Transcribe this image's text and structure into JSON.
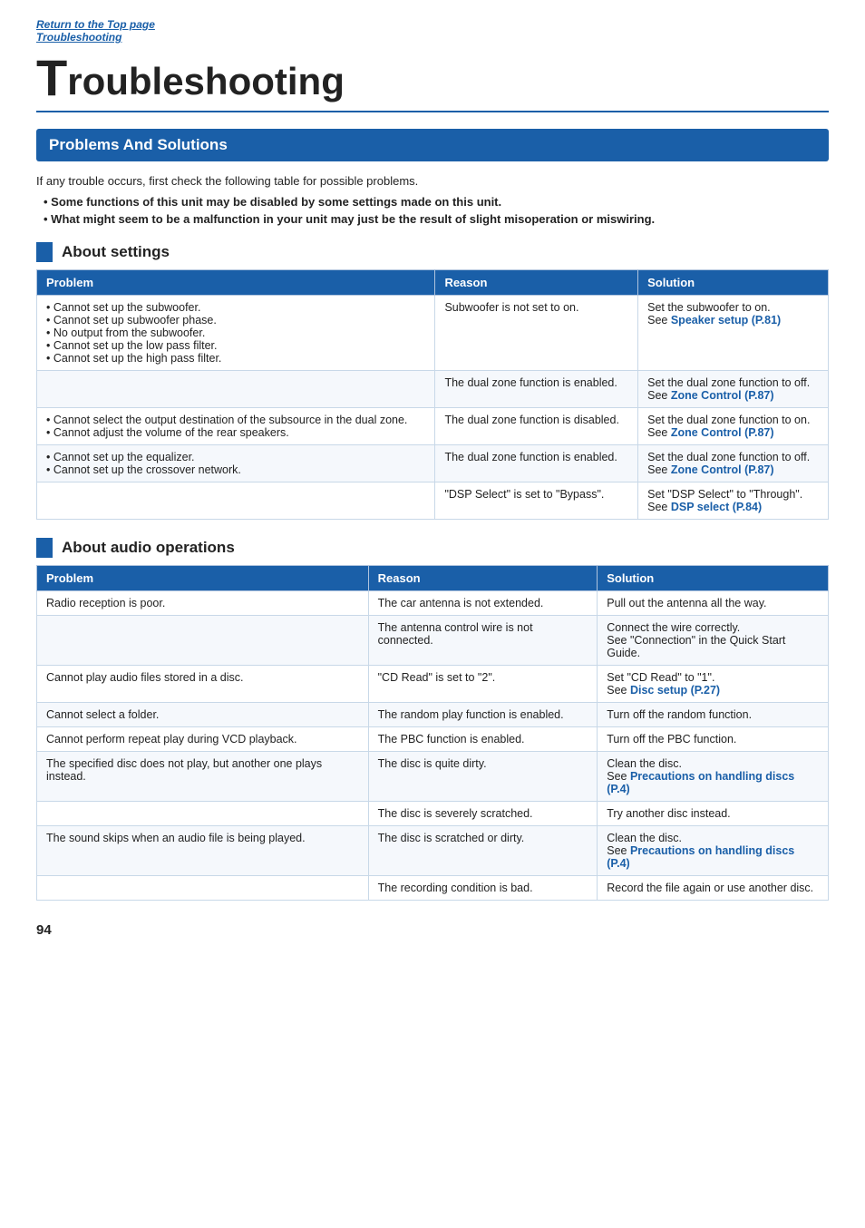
{
  "breadcrumb": {
    "link1": "Return to the Top page",
    "link2": "Troubleshooting"
  },
  "page_title_prefix": "T",
  "page_title_rest": "roubleshooting",
  "main_section": "Problems And Solutions",
  "intro": {
    "line1": "If any trouble occurs, first check the following table for possible problems.",
    "bullet1": "Some functions of this unit may be disabled by some settings made on this unit.",
    "bullet2": "What might seem to be a malfunction in your unit may just be the result of slight misoperation or miswiring."
  },
  "about_settings": {
    "title": "About settings",
    "columns": [
      "Problem",
      "Reason",
      "Solution"
    ],
    "rows": [
      {
        "problem": "• Cannot set up the subwoofer.\n• Cannot set up subwoofer phase.\n• No output from the subwoofer.\n• Cannot set up the low pass filter.\n• Cannot set up the high pass filter.",
        "reason": "Subwoofer is not set to on.",
        "solution": "Set the subwoofer to on.\nSee ",
        "solution_link": "Speaker setup (P.81)",
        "solution_end": ""
      },
      {
        "problem": "",
        "reason": "The dual zone function is enabled.",
        "solution": "Set the dual zone function to off.\nSee ",
        "solution_link": "Zone Control (P.87)",
        "solution_end": ""
      },
      {
        "problem": "• Cannot select the output destination of the subsource in the dual zone.\n• Cannot adjust the volume of the rear speakers.",
        "reason": "The dual zone function is disabled.",
        "solution": "Set the dual zone function to on.\nSee ",
        "solution_link": "Zone Control (P.87)",
        "solution_end": ""
      },
      {
        "problem": "• Cannot set up the equalizer.\n• Cannot set up the crossover network.",
        "reason": "The dual zone function is enabled.",
        "solution": "Set the dual zone function to off.\nSee ",
        "solution_link": "Zone Control (P.87)",
        "solution_end": ""
      },
      {
        "problem": "",
        "reason": "\"DSP Select\" is set to \"Bypass\".",
        "solution": "Set \"DSP Select\" to \"Through\".\nSee ",
        "solution_link": "DSP select (P.84)",
        "solution_end": ""
      }
    ]
  },
  "about_audio": {
    "title": "About audio operations",
    "columns": [
      "Problem",
      "Reason",
      "Solution"
    ],
    "rows": [
      {
        "problem": "Radio reception is poor.",
        "reason": "The car antenna is not extended.",
        "solution": "Pull out the antenna all the way.",
        "solution_link": "",
        "solution_end": ""
      },
      {
        "problem": "",
        "reason": "The antenna control wire is not connected.",
        "solution": "Connect the wire correctly.\nSee \"Connection\" in the Quick Start Guide.",
        "solution_link": "",
        "solution_end": ""
      },
      {
        "problem": "Cannot play audio files stored in a disc.",
        "reason": "\"CD Read\" is set to \"2\".",
        "solution": "Set \"CD Read\" to \"1\".\nSee ",
        "solution_link": "Disc setup (P.27)",
        "solution_end": ""
      },
      {
        "problem": "Cannot select a folder.",
        "reason": "The random play function is enabled.",
        "solution": "Turn off the random function.",
        "solution_link": "",
        "solution_end": ""
      },
      {
        "problem": "Cannot perform repeat play during VCD playback.",
        "reason": "The PBC function is enabled.",
        "solution": "Turn off the PBC function.",
        "solution_link": "",
        "solution_end": ""
      },
      {
        "problem": "The specified disc does not play, but another one plays instead.",
        "reason": "The disc is quite dirty.",
        "solution": "Clean the disc.\nSee ",
        "solution_link": "Precautions on handling discs (P.4)",
        "solution_end": ""
      },
      {
        "problem": "",
        "reason": "The disc is severely scratched.",
        "solution": "Try another disc instead.",
        "solution_link": "",
        "solution_end": ""
      },
      {
        "problem": "The sound skips when an audio file is being played.",
        "reason": "The disc is scratched or dirty.",
        "solution": "Clean the disc.\nSee ",
        "solution_link": "Precautions on handling discs (P.4)",
        "solution_end": ""
      },
      {
        "problem": "",
        "reason": "The recording condition is bad.",
        "solution": "Record the file again or use another disc.",
        "solution_link": "",
        "solution_end": ""
      }
    ]
  },
  "page_number": "94"
}
